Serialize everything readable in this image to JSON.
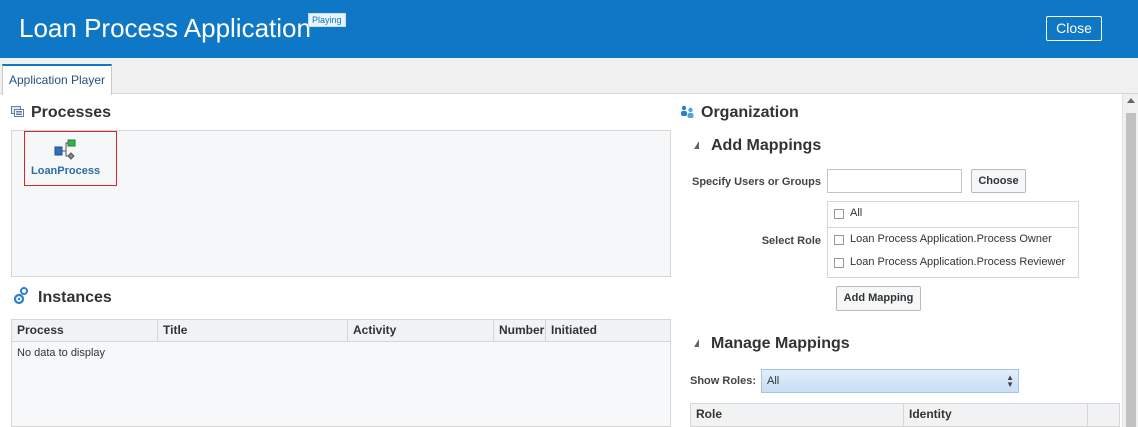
{
  "header": {
    "title": "Loan Process Application",
    "badge": "Playing",
    "close_label": "Close",
    "bg_color": "#0e78c6"
  },
  "tabs": [
    {
      "label": "Application Player",
      "active": true
    }
  ],
  "processes": {
    "title": "Processes",
    "icon": "processes-icon",
    "items": [
      {
        "label": "LoanProcess",
        "icon": "process-flow-icon"
      }
    ]
  },
  "instances": {
    "title": "Instances",
    "icon": "gears-icon",
    "columns": [
      "Process",
      "Title",
      "Activity",
      "Number",
      "Initiated"
    ],
    "empty_text": "No data to display"
  },
  "organization": {
    "title": "Organization",
    "icon": "people-icon",
    "add_mappings": {
      "title": "Add Mappings",
      "users_label": "Specify Users or Groups",
      "users_value": "",
      "choose_label": "Choose",
      "role_label": "Select Role",
      "roles": [
        {
          "label": "All",
          "checked": false
        },
        {
          "label": "Loan Process Application.Process Owner",
          "checked": false
        },
        {
          "label": "Loan Process Application.Process Reviewer",
          "checked": false
        }
      ],
      "add_button": "Add Mapping"
    },
    "manage_mappings": {
      "title": "Manage Mappings",
      "show_roles_label": "Show Roles:",
      "show_roles_value": "All",
      "columns": [
        "Role",
        "Identity"
      ]
    }
  }
}
